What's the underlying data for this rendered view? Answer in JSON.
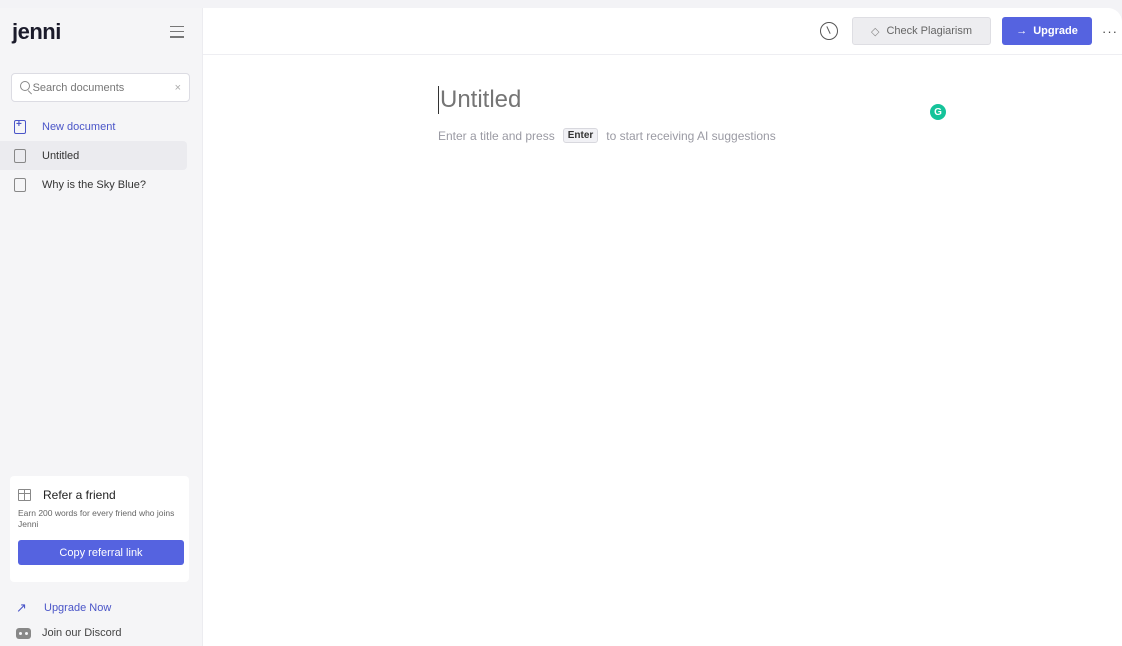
{
  "sidebar": {
    "brand": "jenni",
    "search_placeholder": "Search documents",
    "search_clear": "×",
    "new_document_label": "New document",
    "documents": [
      {
        "label": "Untitled"
      },
      {
        "label": "Why is the Sky Blue?"
      }
    ],
    "refer": {
      "title": "Refer a friend",
      "description": "Earn 200 words for every friend who joins Jenni",
      "button_label": "Copy referral link"
    },
    "upgrade_now_label": "Upgrade Now",
    "discord_label": "Join our Discord"
  },
  "topbar": {
    "check_plagiarism_label": "Check Plagiarism",
    "upgrade_label": "Upgrade",
    "more_label": "···"
  },
  "editor": {
    "title_placeholder": "Untitled",
    "hint_before": "Enter a title and press",
    "hint_key": "Enter",
    "hint_after": "to start receiving AI suggestions"
  },
  "grammarly_badge": "G",
  "colors": {
    "accent": "#5563e0",
    "accent_text": "#4a55c8",
    "grammarly": "#15c39a"
  }
}
